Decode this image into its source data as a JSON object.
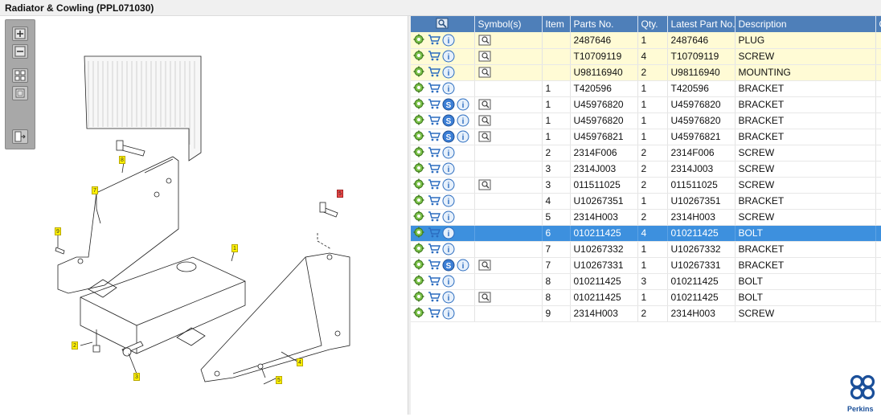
{
  "window": {
    "title": "Radiator & Cowling (PPL071030)"
  },
  "toolbar": {
    "buttons": [
      "zoom-in",
      "zoom-out",
      "fit-page",
      "fit-width",
      "export"
    ]
  },
  "diagram": {
    "callouts": [
      {
        "label": "1",
        "color": "yellow"
      },
      {
        "label": "2",
        "color": "yellow"
      },
      {
        "label": "3",
        "color": "yellow"
      },
      {
        "label": "4",
        "color": "yellow"
      },
      {
        "label": "5",
        "color": "yellow"
      },
      {
        "label": "5",
        "color": "red"
      },
      {
        "label": "7",
        "color": "yellow"
      },
      {
        "label": "8",
        "color": "yellow"
      },
      {
        "label": "9",
        "color": "yellow"
      }
    ]
  },
  "table": {
    "columns": [
      "",
      "Symbol(s)",
      "Item",
      "Parts No.",
      "Qty.",
      "Latest Part No.",
      "Description",
      "C"
    ],
    "rows": [
      {
        "item": "",
        "part": "2487646",
        "qty": "1",
        "latest": "2487646",
        "desc": "PLUG",
        "s": false,
        "sym": true,
        "hl": true
      },
      {
        "item": "",
        "part": "T10709119",
        "qty": "4",
        "latest": "T10709119",
        "desc": "SCREW",
        "s": false,
        "sym": true,
        "hl": true
      },
      {
        "item": "",
        "part": "U98116940",
        "qty": "2",
        "latest": "U98116940",
        "desc": "MOUNTING",
        "s": false,
        "sym": true,
        "hl": true
      },
      {
        "item": "1",
        "part": "T420596",
        "qty": "1",
        "latest": "T420596",
        "desc": "BRACKET",
        "s": false,
        "sym": false
      },
      {
        "item": "1",
        "part": "U45976820",
        "qty": "1",
        "latest": "U45976820",
        "desc": "BRACKET",
        "s": true,
        "sym": true
      },
      {
        "item": "1",
        "part": "U45976820",
        "qty": "1",
        "latest": "U45976820",
        "desc": "BRACKET",
        "s": true,
        "sym": true
      },
      {
        "item": "1",
        "part": "U45976821",
        "qty": "1",
        "latest": "U45976821",
        "desc": "BRACKET",
        "s": true,
        "sym": true
      },
      {
        "item": "2",
        "part": "2314F006",
        "qty": "2",
        "latest": "2314F006",
        "desc": "SCREW",
        "s": false,
        "sym": false
      },
      {
        "item": "3",
        "part": "2314J003",
        "qty": "2",
        "latest": "2314J003",
        "desc": "SCREW",
        "s": false,
        "sym": false
      },
      {
        "item": "3",
        "part": "011511025",
        "qty": "2",
        "latest": "011511025",
        "desc": "SCREW",
        "s": false,
        "sym": true
      },
      {
        "item": "4",
        "part": "U10267351",
        "qty": "1",
        "latest": "U10267351",
        "desc": "BRACKET",
        "s": false,
        "sym": false
      },
      {
        "item": "5",
        "part": "2314H003",
        "qty": "2",
        "latest": "2314H003",
        "desc": "SCREW",
        "s": false,
        "sym": false
      },
      {
        "item": "6",
        "part": "010211425",
        "qty": "4",
        "latest": "010211425",
        "desc": "BOLT",
        "s": false,
        "sym": false,
        "sel": true
      },
      {
        "item": "7",
        "part": "U10267332",
        "qty": "1",
        "latest": "U10267332",
        "desc": "BRACKET",
        "s": false,
        "sym": false
      },
      {
        "item": "7",
        "part": "U10267331",
        "qty": "1",
        "latest": "U10267331",
        "desc": "BRACKET",
        "s": true,
        "sym": true
      },
      {
        "item": "8",
        "part": "010211425",
        "qty": "3",
        "latest": "010211425",
        "desc": "BOLT",
        "s": false,
        "sym": false
      },
      {
        "item": "8",
        "part": "010211425",
        "qty": "1",
        "latest": "010211425",
        "desc": "BOLT",
        "s": false,
        "sym": true
      },
      {
        "item": "9",
        "part": "2314H003",
        "qty": "2",
        "latest": "2314H003",
        "desc": "SCREW",
        "s": false,
        "sym": false
      }
    ]
  },
  "brand": {
    "name": "Perkins",
    "color": "#1a4f99"
  },
  "colors": {
    "header": "#4e7fb9",
    "selected": "#3d90de",
    "highlight": "#fffbd5",
    "callout": "#fff200"
  }
}
